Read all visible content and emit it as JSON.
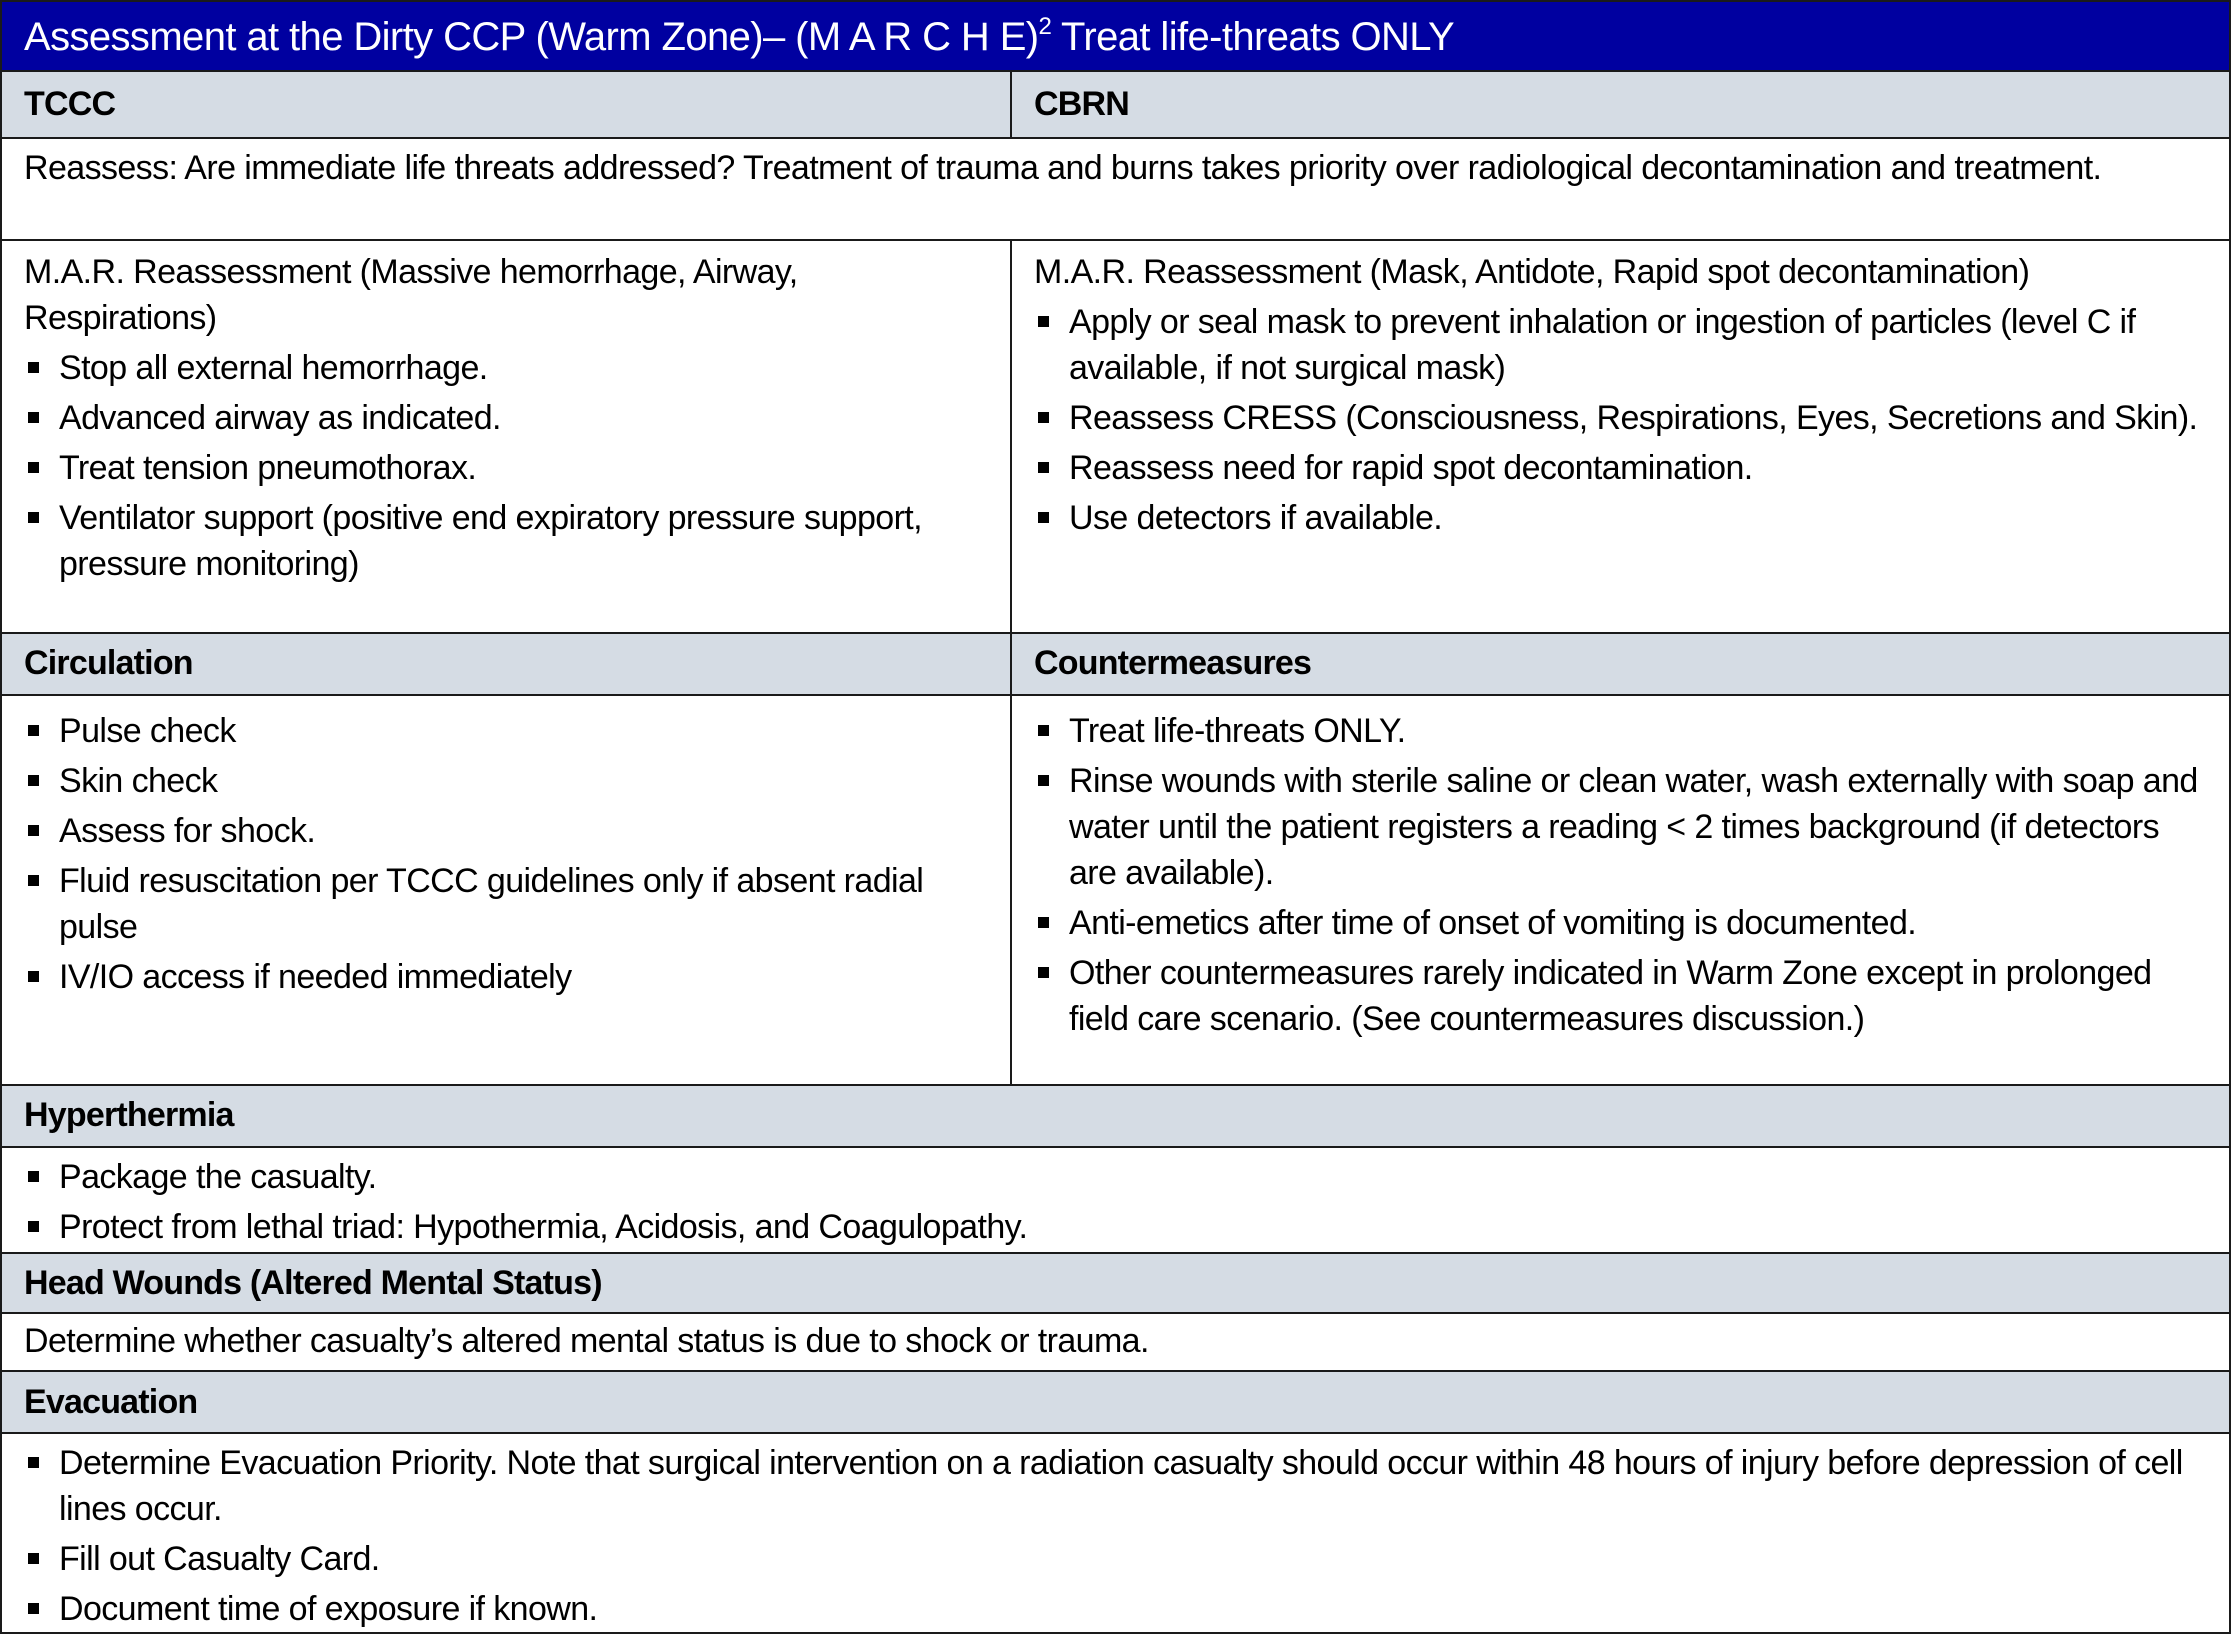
{
  "title": {
    "prefix": "Assessment at the Dirty CCP (Warm Zone)– (M A R C H E)",
    "superscript": "2",
    "suffix": " Treat life-threats ONLY"
  },
  "colors": {
    "title_bg": "#0000a0",
    "header_bg": "#d5dce4",
    "border": "#1a1a1a"
  },
  "columns": {
    "left": "TCCC",
    "right": "CBRN"
  },
  "reassess_text": "Reassess: Are immediate life threats addressed? Treatment of trauma and burns takes priority over radiological decontamination and treatment.",
  "mar": {
    "left": {
      "intro": "M.A.R. Reassessment (Massive hemorrhage, Airway, Respirations)",
      "items": [
        "Stop all external hemorrhage.",
        "Advanced airway as indicated.",
        "Treat tension pneumothorax.",
        "Ventilator support (positive end expiratory pressure support, pressure monitoring)"
      ]
    },
    "right": {
      "intro": "M.A.R. Reassessment (Mask, Antidote, Rapid spot decontamination)",
      "items": [
        "Apply or seal mask to prevent inhalation or ingestion of particles (level C if available, if not surgical mask)",
        "Reassess CRESS (Consciousness, Respirations, Eyes, Secretions and Skin).",
        "Reassess need for rapid spot decontamination.",
        "Use detectors if available."
      ]
    }
  },
  "circulation": {
    "heading": "Circulation",
    "items": [
      "Pulse check",
      "Skin check",
      "Assess for shock.",
      "Fluid resuscitation per TCCC guidelines only if absent radial pulse",
      "IV/IO access if needed immediately"
    ]
  },
  "countermeasures": {
    "heading": "Countermeasures",
    "items": [
      "Treat life-threats ONLY.",
      "Rinse wounds with sterile saline or clean water, wash externally with soap and water until the patient registers a reading < 2 times background (if detectors are available).",
      "Anti-emetics after time of onset of vomiting is documented.",
      "Other countermeasures rarely indicated in Warm Zone except in prolonged field care scenario.  (See countermeasures discussion.)"
    ]
  },
  "hyperthermia": {
    "heading": "Hyperthermia",
    "items": [
      "Package the casualty.",
      "Protect from lethal triad: Hypothermia, Acidosis, and Coagulopathy."
    ]
  },
  "head_wounds": {
    "heading": "Head Wounds (Altered Mental Status)",
    "text": "Determine whether casualty’s altered mental status is due to shock or trauma."
  },
  "evacuation": {
    "heading": "Evacuation",
    "items": [
      "Determine Evacuation Priority. Note that surgical intervention on a radiation casualty should occur within 48 hours of injury before depression of cell lines occur.",
      "Fill out Casualty Card.",
      "Document time of exposure if known."
    ]
  }
}
